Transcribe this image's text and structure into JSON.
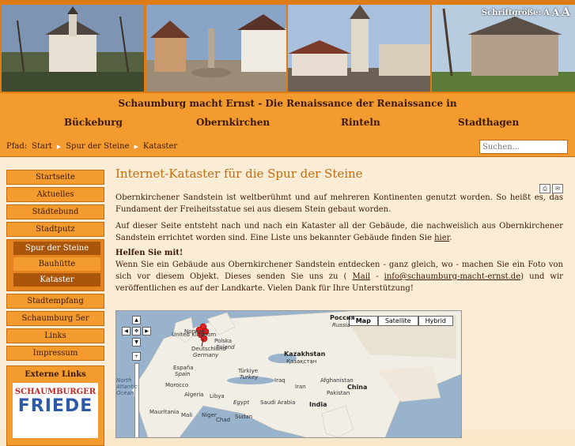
{
  "header": {
    "fontsize_label": "Schriftgröße:",
    "fontsize_options": [
      "A",
      "A",
      "A"
    ]
  },
  "site_title": "Schaumburg macht Ernst - Die Renaissance der Renaissance in",
  "cities": [
    "Bückeburg",
    "Obernkirchen",
    "Rinteln",
    "Stadthagen"
  ],
  "path": {
    "label": "Pfad:",
    "crumbs": [
      "Start",
      "Spur der Steine",
      "Kataster"
    ]
  },
  "search": {
    "placeholder": "Suchen..."
  },
  "sidebar": {
    "items": [
      "Startseite",
      "Aktuelles",
      "Städtebund",
      "Stadtputz",
      "Spur der Steine",
      "Bauhütte",
      "Kataster",
      "Stadtempfang",
      "Schaumburg 5er",
      "Links",
      "Impressum"
    ],
    "external_title": "Externe Links",
    "friede_line1": "SCHAUMBURGER",
    "friede_line2": "FRIEDE"
  },
  "main": {
    "heading": "Internet-Kataster für die Spur der Steine",
    "para1": "Obernkirchener Sandstein ist weltberühmt und auf mehreren Kontinenten genutzt worden. So heißt es, das Fundament der Freiheitsstatue sei aus diesem Stein gebaut worden.",
    "para2_pre": "Auf dieser Seite entsteht nach und nach ein Kataster all der Gebäude, die nachweislich aus Obernkirchener Sandstein errichtet worden sind. Eine Liste uns bekannter Gebäude finden Sie ",
    "para2_link": "hier",
    "para2_post": ".",
    "help": "Helfen Sie mit!",
    "para3_pre": "Wenn Sie ein Gebäude aus Obernkirchener Sandstein entdecken - ganz gleich, wo - machen Sie ein Foto von sich vor diesem Objekt. Dieses senden Sie uns zu ( ",
    "para3_mail": "Mail",
    "para3_mid": " - ",
    "para3_email": "info@schaumburg-macht-ernst.de",
    "para3_post": ") und wir veröffentlichen es auf der Landkarte. Vielen Dank für Ihre Unterstützung!"
  },
  "map": {
    "types": [
      "Map",
      "Satellite",
      "Hybrid"
    ],
    "labels": [
      "Россия",
      "Russia",
      "United Kingdom",
      "Deutschland",
      "Germany",
      "Polska",
      "Poland",
      "Kazakhstan",
      "Қазақстан",
      "España",
      "Spain",
      "Türkiye",
      "Turkey",
      "Iran",
      "Algeria",
      "Libya",
      "Egypt",
      "Saudi Arabia",
      "Pakistan",
      "China",
      "India",
      "Mauritania",
      "Mali",
      "Niger",
      "Chad",
      "Sudan",
      "Norway",
      "North Atlantic Ocean",
      "Morocco",
      "Iraq",
      "Afghanistan"
    ]
  }
}
